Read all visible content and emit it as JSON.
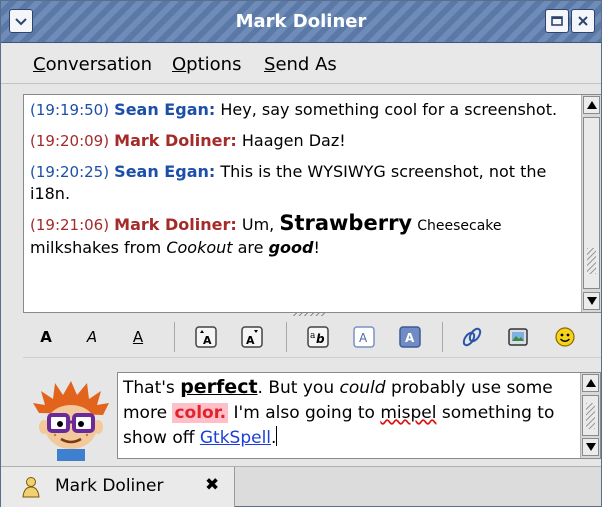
{
  "window": {
    "title": "Mark Doliner"
  },
  "menu": {
    "items": [
      {
        "label": "Conversation",
        "underline": "C",
        "rest": "onversation"
      },
      {
        "label": "Options",
        "underline": "O",
        "rest": "ptions"
      },
      {
        "label": "Send As",
        "underline": "S",
        "rest": "end As"
      }
    ]
  },
  "chat": {
    "messages": [
      {
        "time": "(19:19:50)",
        "sender": "Sean Egan:",
        "color": "#1c4fa8",
        "text": "Hey, say something cool for a screenshot."
      },
      {
        "time": "(19:20:09)",
        "sender": "Mark Doliner:",
        "color": "#a52a2a",
        "text": "Haagen Daz!"
      },
      {
        "time": "(19:20:25)",
        "sender": "Sean Egan:",
        "color": "#1c4fa8",
        "text": "This is the WYSIWYG screenshot, not the i18n."
      },
      {
        "time": "(19:21:06)",
        "sender": "Mark Doliner:",
        "color": "#a52a2a",
        "text_parts": {
          "p1": "Um,",
          "strawberry": "Strawberry",
          "cheesecake": "Cheesecake",
          "p2": "milkshakes from",
          "cookout": "Cookout",
          "p3": "are",
          "good": "good",
          "p4": "!"
        }
      }
    ]
  },
  "toolbar": {
    "icons": [
      "bold-a",
      "italic-a",
      "underline-a",
      "grow-font",
      "shrink-font",
      "font-face",
      "text-color",
      "background-color",
      "insert-link",
      "insert-image",
      "smiley"
    ],
    "bold_label": "A",
    "italic_label": "A",
    "underline_label": "A"
  },
  "entry": {
    "parts": {
      "t1": "That's",
      "perfect": "perfect",
      "t2": ". But you",
      "could": "could",
      "t3": "probably use some more",
      "color": "color.",
      "t4": "I'm also going to",
      "mispel": "mispel",
      "t5": "something to show off",
      "gtkspell": "GtkSpell",
      "t6": "."
    },
    "highlight_color": "#e0242e"
  },
  "tabs": [
    {
      "label": "Mark Doliner",
      "close": "✖"
    }
  ]
}
